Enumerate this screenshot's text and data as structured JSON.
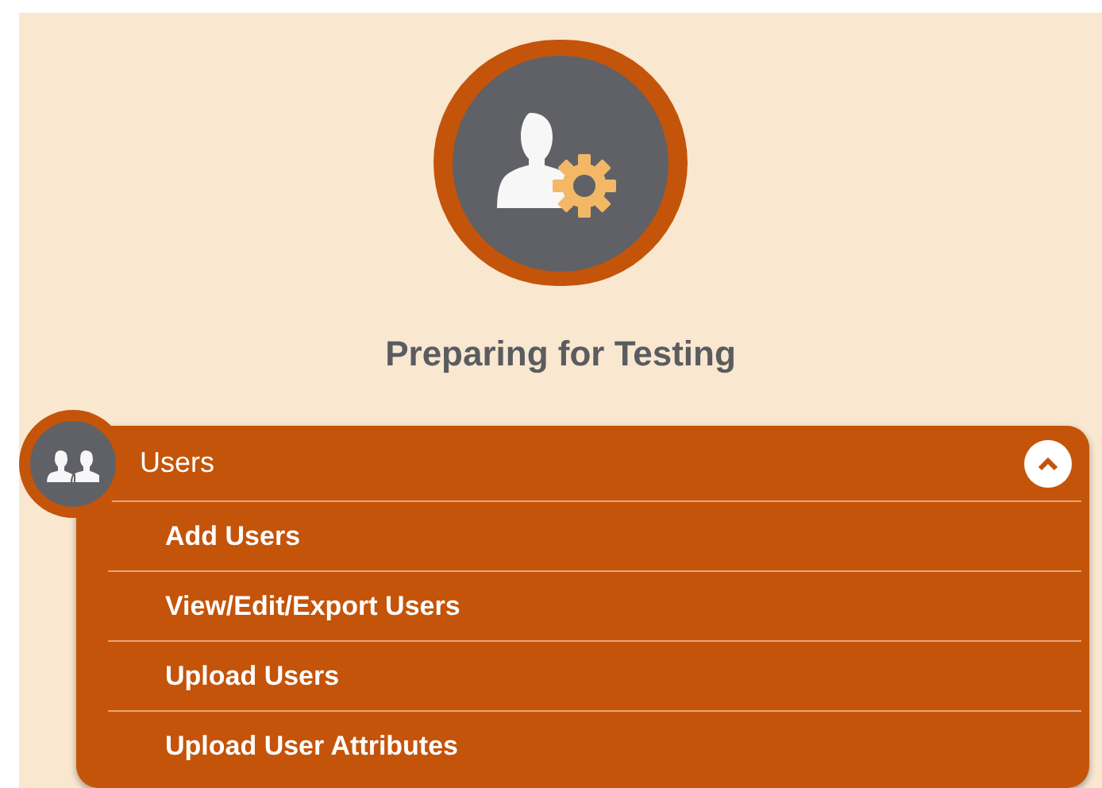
{
  "title": "Preparing for Testing",
  "section": {
    "label": "Users",
    "expanded": true,
    "items": [
      {
        "label": "Add Users"
      },
      {
        "label": "View/Edit/Export Users"
      },
      {
        "label": "Upload Users"
      },
      {
        "label": "Upload User Attributes"
      }
    ]
  }
}
